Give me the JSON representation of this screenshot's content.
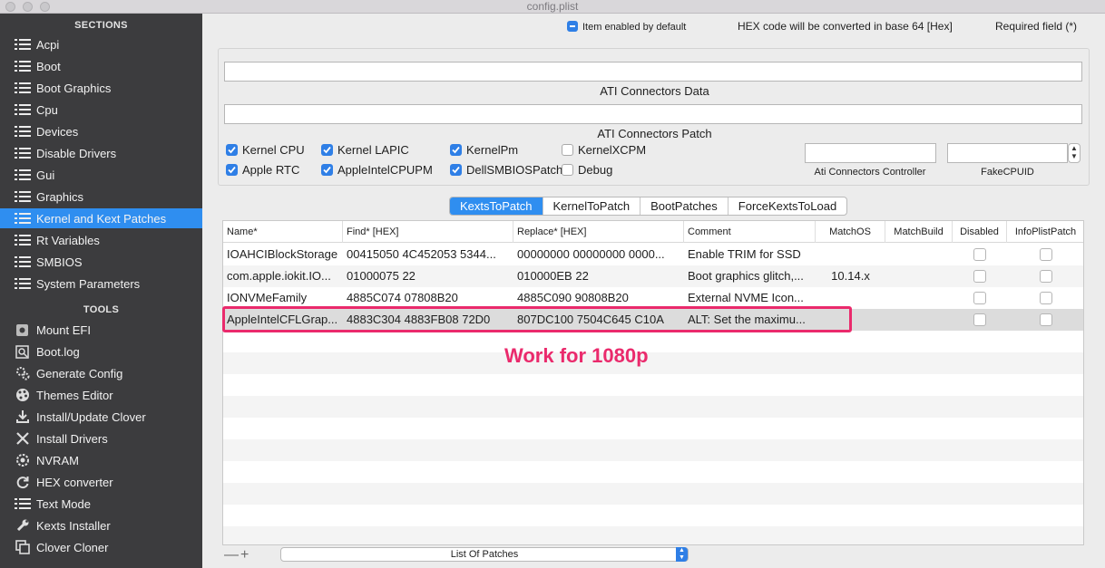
{
  "window": {
    "title": "config.plist"
  },
  "sidebar": {
    "sections_header": "SECTIONS",
    "sections": [
      {
        "label": "Acpi",
        "icon": "list-icon"
      },
      {
        "label": "Boot",
        "icon": "list-icon"
      },
      {
        "label": "Boot Graphics",
        "icon": "list-icon"
      },
      {
        "label": "Cpu",
        "icon": "list-icon"
      },
      {
        "label": "Devices",
        "icon": "list-icon"
      },
      {
        "label": "Disable Drivers",
        "icon": "list-icon"
      },
      {
        "label": "Gui",
        "icon": "list-icon"
      },
      {
        "label": "Graphics",
        "icon": "list-icon"
      },
      {
        "label": "Kernel and Kext Patches",
        "icon": "list-icon",
        "selected": true
      },
      {
        "label": "Rt Variables",
        "icon": "list-icon"
      },
      {
        "label": "SMBIOS",
        "icon": "list-icon"
      },
      {
        "label": "System Parameters",
        "icon": "list-icon"
      }
    ],
    "tools_header": "TOOLS",
    "tools": [
      {
        "label": "Mount EFI",
        "icon": "disk-icon"
      },
      {
        "label": "Boot.log",
        "icon": "log-icon"
      },
      {
        "label": "Generate Config",
        "icon": "gears-icon"
      },
      {
        "label": "Themes Editor",
        "icon": "palette-icon"
      },
      {
        "label": "Install/Update Clover",
        "icon": "download-icon"
      },
      {
        "label": "Install Drivers",
        "icon": "tools-icon"
      },
      {
        "label": "NVRAM",
        "icon": "chip-icon"
      },
      {
        "label": "HEX converter",
        "icon": "refresh-icon"
      },
      {
        "label": "Text Mode",
        "icon": "list-icon"
      },
      {
        "label": "Kexts Installer",
        "icon": "wrench-icon"
      },
      {
        "label": "Clover Cloner",
        "icon": "copy-icon"
      }
    ]
  },
  "header": {
    "item_enabled": "Item enabled by default",
    "hex_note": "HEX code will be converted in base 64 [Hex]",
    "required": "Required field (*)"
  },
  "panel": {
    "ati_data_label": "ATI Connectors Data",
    "ati_data_value": "",
    "ati_patch_label": "ATI Connectors Patch",
    "ati_patch_value": "",
    "checkboxes_row1": [
      {
        "label": "Kernel CPU",
        "checked": true
      },
      {
        "label": "Kernel LAPIC",
        "checked": true
      },
      {
        "label": "KernelPm",
        "checked": true
      },
      {
        "label": "KernelXCPM",
        "checked": false
      }
    ],
    "checkboxes_row2": [
      {
        "label": "Apple RTC",
        "checked": true
      },
      {
        "label": "AppleIntelCPUPM",
        "checked": true
      },
      {
        "label": "DellSMBIOSPatch",
        "checked": true
      },
      {
        "label": "Debug",
        "checked": false
      }
    ],
    "ati_controller_label": "Ati Connectors Controller",
    "ati_controller_value": "",
    "fakecpuid_label": "FakeCPUID",
    "fakecpuid_value": ""
  },
  "tabs": [
    {
      "label": "KextsToPatch",
      "active": true
    },
    {
      "label": "KernelToPatch",
      "active": false
    },
    {
      "label": "BootPatches",
      "active": false
    },
    {
      "label": "ForceKextsToLoad",
      "active": false
    }
  ],
  "table": {
    "columns": [
      "Name*",
      "Find* [HEX]",
      "Replace* [HEX]",
      "Comment",
      "MatchOS",
      "MatchBuild",
      "Disabled",
      "InfoPlistPatch"
    ],
    "rows": [
      {
        "name": "IOAHCIBlockStorage",
        "find": "00415050 4C452053 5344...",
        "replace": "00000000 00000000 0000...",
        "comment": "Enable TRIM for SSD",
        "matchos": "",
        "matchbuild": "",
        "disabled": false,
        "infoplist": false
      },
      {
        "name": "com.apple.iokit.IO...",
        "find": "01000075 22",
        "replace": "010000EB 22",
        "comment": "Boot graphics glitch,...",
        "matchos": "10.14.x",
        "matchbuild": "",
        "disabled": false,
        "infoplist": false
      },
      {
        "name": "IONVMeFamily",
        "find": "4885C074 07808B20",
        "replace": "4885C090 90808B20",
        "comment": "External NVME Icon...",
        "matchos": "",
        "matchbuild": "",
        "disabled": false,
        "infoplist": false
      },
      {
        "name": "AppleIntelCFLGrap...",
        "find": "4883C304 4883FB08 72D0",
        "replace": "807DC100 7504C645 C10A",
        "comment": "ALT: Set the maximu...",
        "matchos": "",
        "matchbuild": "",
        "disabled": false,
        "infoplist": false
      }
    ]
  },
  "annotation": "Work for 1080p",
  "footer": {
    "minus": "—",
    "plus": "+",
    "popup_label": "List Of Patches"
  },
  "colors": {
    "accent": "#2f8ef0",
    "highlight": "#ea2a6c",
    "sidebar_bg": "#3c3c3e"
  }
}
